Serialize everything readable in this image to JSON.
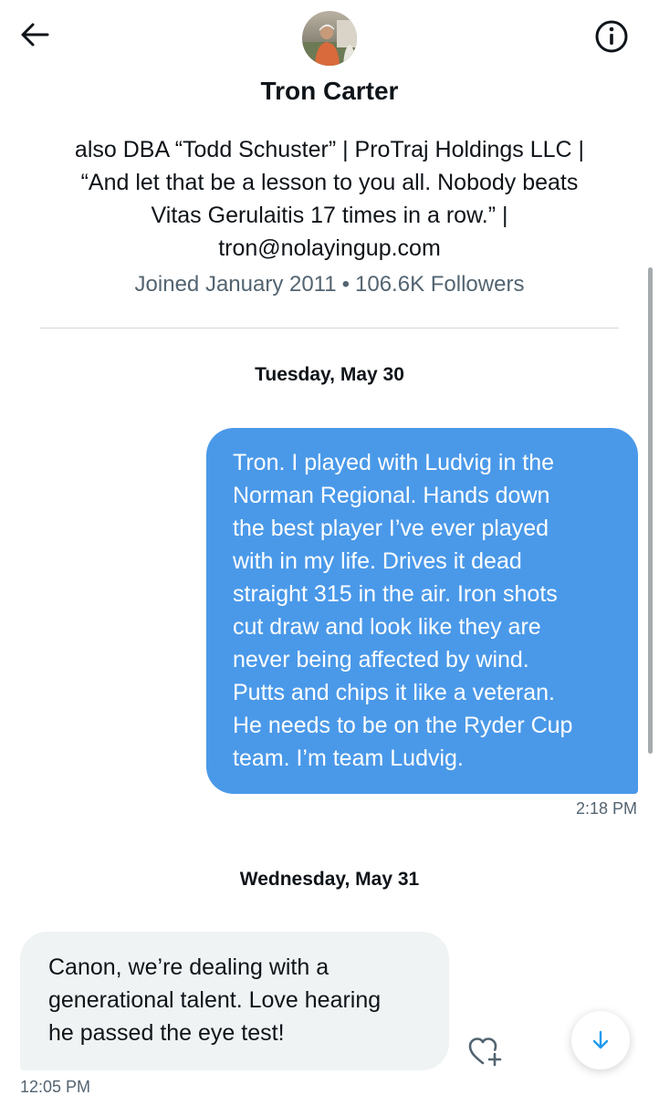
{
  "header": {
    "back_icon": "arrow-left-icon",
    "info_icon": "info-circle-icon"
  },
  "profile": {
    "name": "Tron Carter",
    "bio_lines": [
      "also DBA “Todd Schuster” | ProTraj Holdings LLC |",
      "“And let that be a lesson to you all. Nobody beats",
      "Vitas Gerulaitis 17 times in a row.” |",
      "tron@nolayingup.com"
    ],
    "joined": "Joined January 2011",
    "separator": "•",
    "followers": "106.6K Followers"
  },
  "conversation": {
    "days": [
      {
        "label": "Tuesday, May 30",
        "messages": [
          {
            "direction": "sent",
            "lines": [
              "Tron. I played with Ludvig in the",
              "Norman Regional. Hands down",
              "the best player I’ve ever played",
              "with in my life. Drives it dead",
              "straight 315 in the air. Iron shots",
              "cut draw and look like they are",
              "never being affected by wind.",
              "Putts and chips it like a veteran.",
              "He needs to be on the Ryder Cup",
              "team. I’m team Ludvig."
            ],
            "time": "2:18 PM"
          }
        ]
      },
      {
        "label": "Wednesday, May 31",
        "messages": [
          {
            "direction": "received",
            "lines": [
              "Canon, we’re dealing with a",
              "generational talent. Love hearing",
              "he passed the eye test!"
            ],
            "time": "12:05 PM"
          }
        ]
      }
    ]
  },
  "controls": {
    "react_icon": "heart-plus-icon",
    "scroll_down_icon": "arrow-down-icon"
  },
  "colors": {
    "sent_bubble": "#4a99e9",
    "received_bubble": "#eff3f4",
    "secondary_text": "#536471",
    "accent": "#1d9bf0"
  }
}
